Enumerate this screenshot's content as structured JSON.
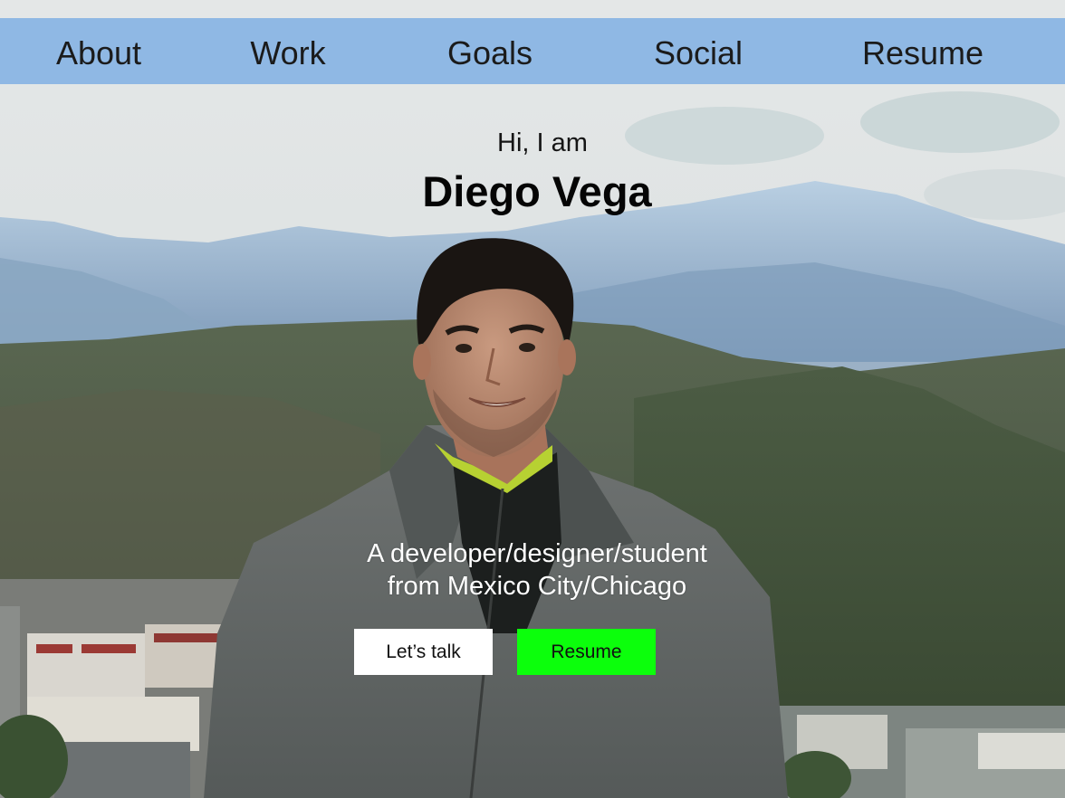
{
  "nav": {
    "items": [
      {
        "label": "About"
      },
      {
        "label": "Work"
      },
      {
        "label": "Goals"
      },
      {
        "label": "Social"
      },
      {
        "label": "Resume"
      }
    ],
    "background": "#8fb8e4"
  },
  "hero": {
    "greeting": "Hi, I am",
    "name": "Diego Vega",
    "tagline_line1": "A developer/designer/student",
    "tagline_line2": "from Mexico City/Chicago",
    "photo": "portrait-in-mountains"
  },
  "buttons": {
    "talk_label": "Let’s talk",
    "resume_label": "Resume",
    "talk_color": "#ffffff",
    "resume_color": "#0cff0c"
  }
}
